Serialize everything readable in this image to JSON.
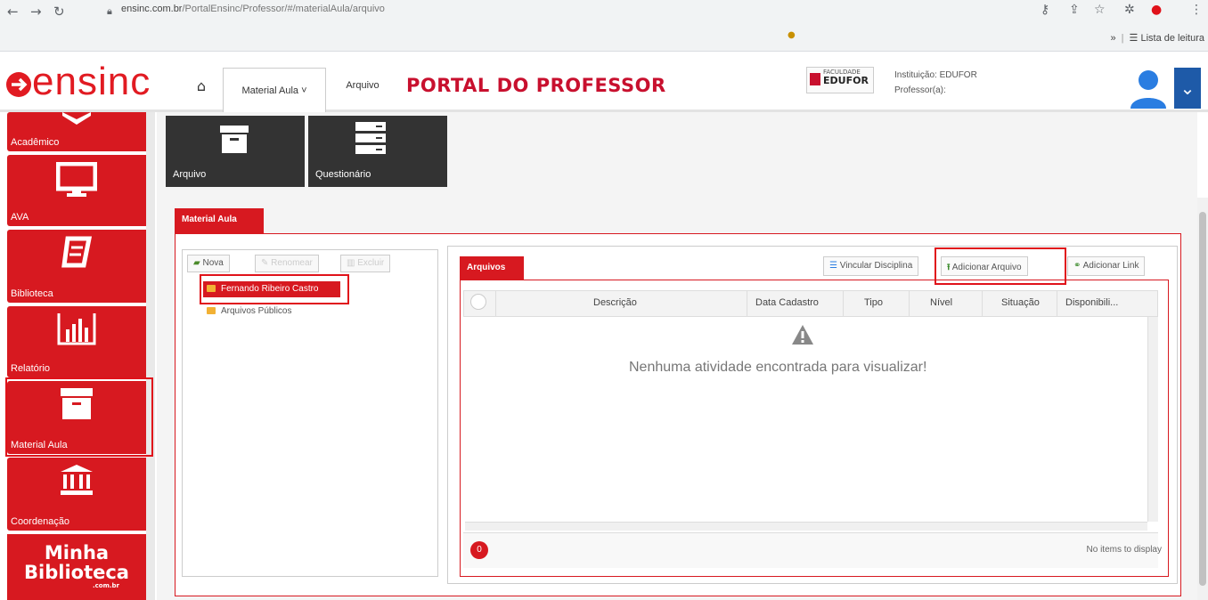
{
  "browser": {
    "url_host": "ensinc.com.br",
    "url_path": "/PortalEnsinc/Professor/#/materialAula/arquivo",
    "reading_list": "Lista de leitura",
    "more": "»"
  },
  "header": {
    "logo": "ensinc",
    "menu_material": "Material Aula ˅",
    "menu_arquivo": "Arquivo",
    "title": "PORTAL DO PROFESSOR",
    "edufor_top": "FACULDADE",
    "edufor_name": "EDUFOR",
    "institution": "Instituição: EDUFOR",
    "professor": "Professor(a):",
    "accent": "#d71920"
  },
  "sidebar": {
    "items": [
      {
        "label": "Acadêmico",
        "icon": "academic-icon"
      },
      {
        "label": "AVA",
        "icon": "monitor-icon"
      },
      {
        "label": "Biblioteca",
        "icon": "book-icon"
      },
      {
        "label": "Relatório",
        "icon": "bar-chart-icon"
      },
      {
        "label": "Material Aula",
        "icon": "archive-box-icon"
      },
      {
        "label": "Coordenação",
        "icon": "institution-icon"
      }
    ],
    "minha_line1": "Minha",
    "minha_line2": "Biblioteca",
    "minha_com": ".com.br"
  },
  "quick": {
    "arquivo": "Arquivo",
    "questionario": "Questionário"
  },
  "panel": {
    "tab": "Material Aula",
    "tree_buttons": {
      "nova": "Nova",
      "renomear": "Renomear",
      "excluir": "Excluir"
    },
    "tree_items": [
      "Fernando Ribeiro Castro",
      "Arquivos Públicos"
    ]
  },
  "files": {
    "tab": "Arquivos",
    "btn_vincular": "Vincular Disciplina",
    "btn_adicionar_arquivo": "Adicionar Arquivo",
    "btn_adicionar_link": "Adicionar Link",
    "columns": [
      "Descrição",
      "Data Cadastro",
      "Tipo",
      "Nível",
      "Situação",
      "Disponibili..."
    ],
    "empty_message": "Nenhuma atividade encontrada para visualizar!",
    "page_count": "0",
    "footer": "No items to display"
  }
}
